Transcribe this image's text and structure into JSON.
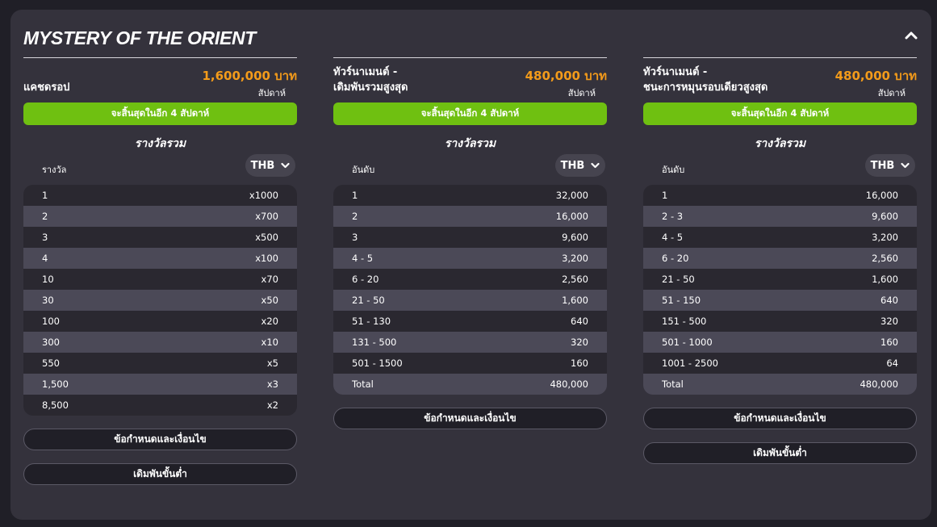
{
  "title": "MYSTERY OF THE ORIENT",
  "columns": [
    {
      "name": "แคชดรอป",
      "amount": "1,600,000 บาท",
      "period": "สัปดาห์",
      "ends": "จะสิ้นสุดในอีก 4 สัปดาห์",
      "pool_title": "รางวัลรวม",
      "header_label": "รางวัล",
      "currency": "THB",
      "rows": [
        [
          "1",
          "x1000"
        ],
        [
          "2",
          "x700"
        ],
        [
          "3",
          "x500"
        ],
        [
          "4",
          "x100"
        ],
        [
          "10",
          "x70"
        ],
        [
          "30",
          "x50"
        ],
        [
          "100",
          "x20"
        ],
        [
          "300",
          "x10"
        ],
        [
          "550",
          "x5"
        ],
        [
          "1,500",
          "x3"
        ],
        [
          "8,500",
          "x2"
        ]
      ],
      "buttons": [
        "ข้อกำหนดและเงื่อนไข",
        "เดิมพันขั้นต่ำ"
      ]
    },
    {
      "name": "ทัวร์นาเมนต์ -\nเดิมพันรวมสูงสุด",
      "amount": "480,000 บาท",
      "period": "สัปดาห์",
      "ends": "จะสิ้นสุดในอีก 4 สัปดาห์",
      "pool_title": "รางวัลรวม",
      "header_label": "อันดับ",
      "currency": "THB",
      "rows": [
        [
          "1",
          "32,000"
        ],
        [
          "2",
          "16,000"
        ],
        [
          "3",
          "9,600"
        ],
        [
          "4 - 5",
          "3,200"
        ],
        [
          "6 - 20",
          "2,560"
        ],
        [
          "21 - 50",
          "1,600"
        ],
        [
          "51 - 130",
          "640"
        ],
        [
          "131 - 500",
          "320"
        ],
        [
          "501 - 1500",
          "160"
        ],
        [
          "Total",
          "480,000"
        ]
      ],
      "buttons": [
        "ข้อกำหนดและเงื่อนไข"
      ]
    },
    {
      "name": "ทัวร์นาเมนต์ -\nชนะการหมุนรอบเดียวสูงสุด",
      "amount": "480,000 บาท",
      "period": "สัปดาห์",
      "ends": "จะสิ้นสุดในอีก 4 สัปดาห์",
      "pool_title": "รางวัลรวม",
      "header_label": "อันดับ",
      "currency": "THB",
      "rows": [
        [
          "1",
          "16,000"
        ],
        [
          "2 - 3",
          "9,600"
        ],
        [
          "4 - 5",
          "3,200"
        ],
        [
          "6 - 20",
          "2,560"
        ],
        [
          "21 - 50",
          "1,600"
        ],
        [
          "51 - 150",
          "640"
        ],
        [
          "151 - 500",
          "320"
        ],
        [
          "501 - 1000",
          "160"
        ],
        [
          "1001 - 2500",
          "64"
        ],
        [
          "Total",
          "480,000"
        ]
      ],
      "buttons": [
        "ข้อกำหนดและเงื่อนไข",
        "เดิมพันขั้นต่ำ"
      ]
    }
  ],
  "colors": {
    "page_bg": "#201f27",
    "panel_bg": "#34323c",
    "accent_green": "#6fc011",
    "amount_orange": "#f39b1a",
    "row_dark": "#2a2830",
    "row_light": "#4b4957"
  },
  "icons": {
    "collapse": "chevron-up-icon",
    "currency_dropdown": "chevron-down-icon"
  }
}
